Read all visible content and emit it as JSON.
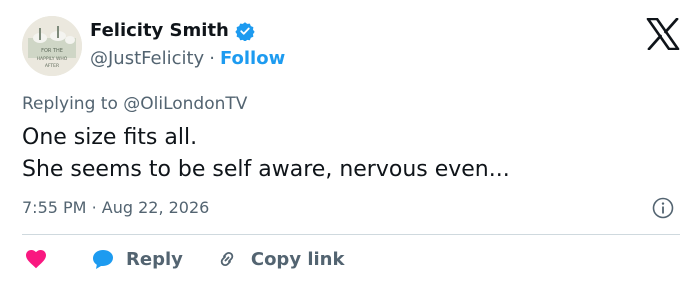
{
  "author": {
    "name": "Felicity Smith",
    "handle": "@JustFelicity",
    "separator": "·",
    "follow_label": "Follow",
    "avatar_text_top": "FOR THE",
    "avatar_text_mid": "HAPPILY WHO",
    "avatar_text_bot": "AFTER",
    "verified_color": "#1d9bf0"
  },
  "reply_context": {
    "label": "Replying to @OliLondonTV"
  },
  "tweet": {
    "lines": [
      "One size fits all.",
      "She seems to be self aware, nervous even..."
    ]
  },
  "timestamp": {
    "time": "7:55 PM",
    "separator": "·",
    "date": "Aug 22, 2026"
  },
  "actions": {
    "like_icon": "heart-icon",
    "reply_label": "Reply",
    "copy_link_label": "Copy link"
  },
  "colors": {
    "accent": "#1d9bf0",
    "like": "#f91880",
    "secondary_text": "#536471"
  }
}
